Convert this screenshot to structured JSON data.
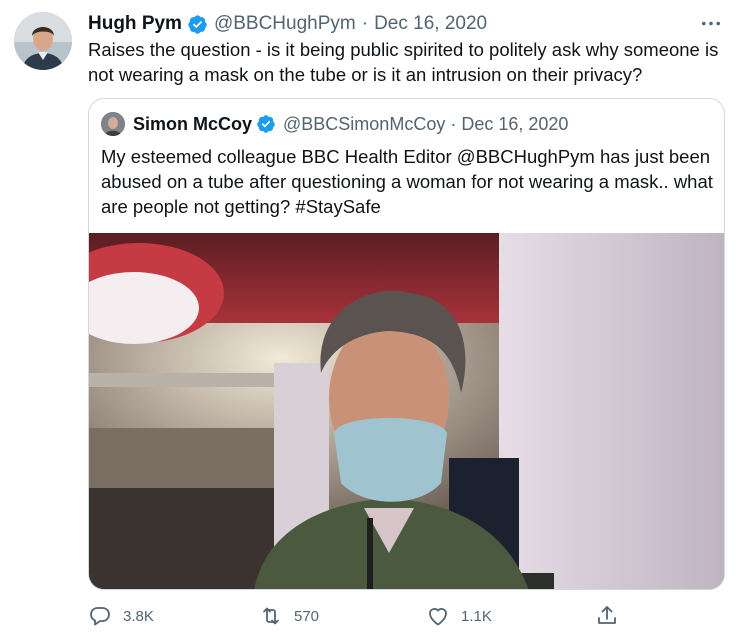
{
  "tweet": {
    "author": {
      "display_name": "Hugh Pym",
      "handle": "@BBCHughPym",
      "verified": true,
      "avatar": "profile-photo"
    },
    "separator": "·",
    "date": "Dec 16, 2020",
    "text": "Raises the question - is it being public spirited to politely ask why someone is not wearing a mask on the tube or is it an intrusion on their  privacy?",
    "more_icon": "more-horizontal-icon"
  },
  "quoted_tweet": {
    "author": {
      "display_name": "Simon McCoy",
      "handle": "@BBCSimonMcCoy",
      "verified": true,
      "avatar": "profile-photo"
    },
    "separator": "·",
    "date": "Dec 16, 2020",
    "text": "My esteemed colleague BBC Health Editor @BBCHughPym  has just been abused on a tube after questioning a woman for not wearing a mask.. what are people not getting? #StaySafe",
    "media": "photo"
  },
  "actions": {
    "reply": {
      "icon": "reply-icon",
      "count": "3.8K"
    },
    "retweet": {
      "icon": "retweet-icon",
      "count": "570"
    },
    "like": {
      "icon": "heart-icon",
      "count": "1.1K"
    },
    "share": {
      "icon": "share-icon"
    }
  },
  "colors": {
    "verified": "#1d9bf0",
    "text_primary": "#0f1419",
    "text_secondary": "#536471",
    "border": "#cfd9de",
    "background": "#ffffff"
  }
}
